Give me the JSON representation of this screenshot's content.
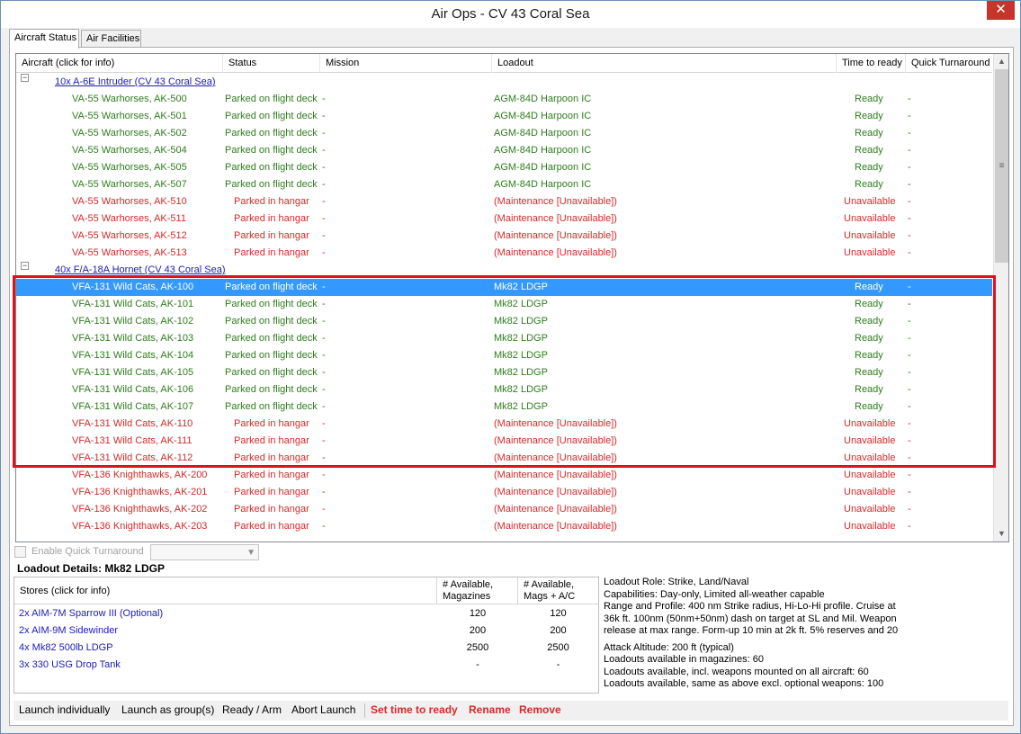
{
  "window": {
    "title": "Air Ops - CV 43 Coral Sea",
    "close_symbol": "✕"
  },
  "tabs": [
    {
      "label": "Aircraft Status"
    },
    {
      "label": "Air Facilities"
    }
  ],
  "grid": {
    "headers": [
      "Aircraft (click for info)",
      "Status",
      "Mission",
      "Loadout",
      "Time to ready",
      "Quick Turnaround"
    ],
    "groups": [
      {
        "name": "10x A-6E Intruder (CV 43 Coral Sea)",
        "rows": [
          {
            "aircraft": "VA-55 Warhorses, AK-500",
            "status": "Parked on flight deck",
            "mission": "-",
            "loadout": "AGM-84D Harpoon IC",
            "time": "Ready",
            "qt": "-",
            "state": "green"
          },
          {
            "aircraft": "VA-55 Warhorses, AK-501",
            "status": "Parked on flight deck",
            "mission": "-",
            "loadout": "AGM-84D Harpoon IC",
            "time": "Ready",
            "qt": "-",
            "state": "green"
          },
          {
            "aircraft": "VA-55 Warhorses, AK-502",
            "status": "Parked on flight deck",
            "mission": "-",
            "loadout": "AGM-84D Harpoon IC",
            "time": "Ready",
            "qt": "-",
            "state": "green"
          },
          {
            "aircraft": "VA-55 Warhorses, AK-504",
            "status": "Parked on flight deck",
            "mission": "-",
            "loadout": "AGM-84D Harpoon IC",
            "time": "Ready",
            "qt": "-",
            "state": "green"
          },
          {
            "aircraft": "VA-55 Warhorses, AK-505",
            "status": "Parked on flight deck",
            "mission": "-",
            "loadout": "AGM-84D Harpoon IC",
            "time": "Ready",
            "qt": "-",
            "state": "green"
          },
          {
            "aircraft": "VA-55 Warhorses, AK-507",
            "status": "Parked on flight deck",
            "mission": "-",
            "loadout": "AGM-84D Harpoon IC",
            "time": "Ready",
            "qt": "-",
            "state": "green"
          },
          {
            "aircraft": "VA-55 Warhorses, AK-510",
            "status": "Parked in hangar",
            "mission": "-",
            "loadout": "(Maintenance [Unavailable])",
            "time": "Unavailable",
            "qt": "-",
            "state": "red"
          },
          {
            "aircraft": "VA-55 Warhorses, AK-511",
            "status": "Parked in hangar",
            "mission": "-",
            "loadout": "(Maintenance [Unavailable])",
            "time": "Unavailable",
            "qt": "-",
            "state": "red"
          },
          {
            "aircraft": "VA-55 Warhorses, AK-512",
            "status": "Parked in hangar",
            "mission": "-",
            "loadout": "(Maintenance [Unavailable])",
            "time": "Unavailable",
            "qt": "-",
            "state": "red"
          },
          {
            "aircraft": "VA-55 Warhorses, AK-513",
            "status": "Parked in hangar",
            "mission": "-",
            "loadout": "(Maintenance [Unavailable])",
            "time": "Unavailable",
            "qt": "-",
            "state": "red"
          }
        ]
      },
      {
        "name": "40x F/A-18A Hornet (CV 43 Coral Sea)",
        "rows": [
          {
            "aircraft": "VFA-131 Wild Cats, AK-100",
            "status": "Parked on flight deck",
            "mission": "-",
            "loadout": "Mk82 LDGP",
            "time": "Ready",
            "qt": "-",
            "state": "selected"
          },
          {
            "aircraft": "VFA-131 Wild Cats, AK-101",
            "status": "Parked on flight deck",
            "mission": "-",
            "loadout": "Mk82 LDGP",
            "time": "Ready",
            "qt": "-",
            "state": "green"
          },
          {
            "aircraft": "VFA-131 Wild Cats, AK-102",
            "status": "Parked on flight deck",
            "mission": "-",
            "loadout": "Mk82 LDGP",
            "time": "Ready",
            "qt": "-",
            "state": "green"
          },
          {
            "aircraft": "VFA-131 Wild Cats, AK-103",
            "status": "Parked on flight deck",
            "mission": "-",
            "loadout": "Mk82 LDGP",
            "time": "Ready",
            "qt": "-",
            "state": "green"
          },
          {
            "aircraft": "VFA-131 Wild Cats, AK-104",
            "status": "Parked on flight deck",
            "mission": "-",
            "loadout": "Mk82 LDGP",
            "time": "Ready",
            "qt": "-",
            "state": "green"
          },
          {
            "aircraft": "VFA-131 Wild Cats, AK-105",
            "status": "Parked on flight deck",
            "mission": "-",
            "loadout": "Mk82 LDGP",
            "time": "Ready",
            "qt": "-",
            "state": "green"
          },
          {
            "aircraft": "VFA-131 Wild Cats, AK-106",
            "status": "Parked on flight deck",
            "mission": "-",
            "loadout": "Mk82 LDGP",
            "time": "Ready",
            "qt": "-",
            "state": "green"
          },
          {
            "aircraft": "VFA-131 Wild Cats, AK-107",
            "status": "Parked on flight deck",
            "mission": "-",
            "loadout": "Mk82 LDGP",
            "time": "Ready",
            "qt": "-",
            "state": "green"
          },
          {
            "aircraft": "VFA-131 Wild Cats, AK-110",
            "status": "Parked in hangar",
            "mission": "-",
            "loadout": "(Maintenance [Unavailable])",
            "time": "Unavailable",
            "qt": "-",
            "state": "red"
          },
          {
            "aircraft": "VFA-131 Wild Cats, AK-111",
            "status": "Parked in hangar",
            "mission": "-",
            "loadout": "(Maintenance [Unavailable])",
            "time": "Unavailable",
            "qt": "-",
            "state": "red"
          },
          {
            "aircraft": "VFA-131 Wild Cats, AK-112",
            "status": "Parked in hangar",
            "mission": "-",
            "loadout": "(Maintenance [Unavailable])",
            "time": "Unavailable",
            "qt": "-",
            "state": "red"
          },
          {
            "aircraft": "VFA-136 Knighthawks, AK-200",
            "status": "Parked in hangar",
            "mission": "-",
            "loadout": "(Maintenance [Unavailable])",
            "time": "Unavailable",
            "qt": "-",
            "state": "red"
          },
          {
            "aircraft": "VFA-136 Knighthawks, AK-201",
            "status": "Parked in hangar",
            "mission": "-",
            "loadout": "(Maintenance [Unavailable])",
            "time": "Unavailable",
            "qt": "-",
            "state": "red"
          },
          {
            "aircraft": "VFA-136 Knighthawks, AK-202",
            "status": "Parked in hangar",
            "mission": "-",
            "loadout": "(Maintenance [Unavailable])",
            "time": "Unavailable",
            "qt": "-",
            "state": "red"
          },
          {
            "aircraft": "VFA-136 Knighthawks, AK-203",
            "status": "Parked in hangar",
            "mission": "-",
            "loadout": "(Maintenance [Unavailable])",
            "time": "Unavailable",
            "qt": "-",
            "state": "red"
          }
        ]
      }
    ]
  },
  "quick_turnaround": {
    "label": "Enable Quick Turnaround",
    "checked": false,
    "select_value": ""
  },
  "loadout_details": {
    "title": "Loadout Details: Mk82 LDGP",
    "stores_headers": [
      "Stores (click for info)",
      "# Available,\nMagazines",
      "# Available,\nMags + A/C"
    ],
    "stores": [
      {
        "name": "2x AIM-7M Sparrow III   (Optional)",
        "mags": "120",
        "mags_ac": "120"
      },
      {
        "name": "2x AIM-9M Sidewinder",
        "mags": "200",
        "mags_ac": "200"
      },
      {
        "name": "4x Mk82 500lb LDGP",
        "mags": "2500",
        "mags_ac": "2500"
      },
      {
        "name": "3x 330 USG Drop Tank",
        "mags": "-",
        "mags_ac": "-"
      }
    ],
    "info": [
      "Loadout Role: Strike, Land/Naval",
      "Capabilities: Day-only, Limited all-weather capable",
      "Range and Profile: 400 nm Strike radius, Hi-Lo-Hi profile. Cruise at 36k ft. 100nm (50nm+50nm) dash on target at SL and Mil. Weapon release at max range. Form-up 10 min at 2k ft. 5% reserves and 20",
      "Attack Altitude: 200 ft (typical)",
      "Loadouts available in magazines: 60",
      "Loadouts available, incl. weapons mounted on all aircraft: 60",
      "Loadouts available, same as above excl. optional weapons: 100"
    ]
  },
  "actions": [
    {
      "label": "Launch individually",
      "style": "normal"
    },
    {
      "label": "Launch as group(s)",
      "style": "normal"
    },
    {
      "label": "Ready / Arm",
      "style": "normal"
    },
    {
      "label": "Abort Launch",
      "style": "normal"
    },
    {
      "label": "Set time to ready",
      "style": "red"
    },
    {
      "label": "Rename",
      "style": "red"
    },
    {
      "label": "Remove",
      "style": "red"
    }
  ],
  "colors": {
    "ready": "#2e7d1e",
    "unavailable": "#d42a2a",
    "selected": "#3399ff",
    "link": "#1a1abf",
    "highlight": "#e0111a"
  }
}
